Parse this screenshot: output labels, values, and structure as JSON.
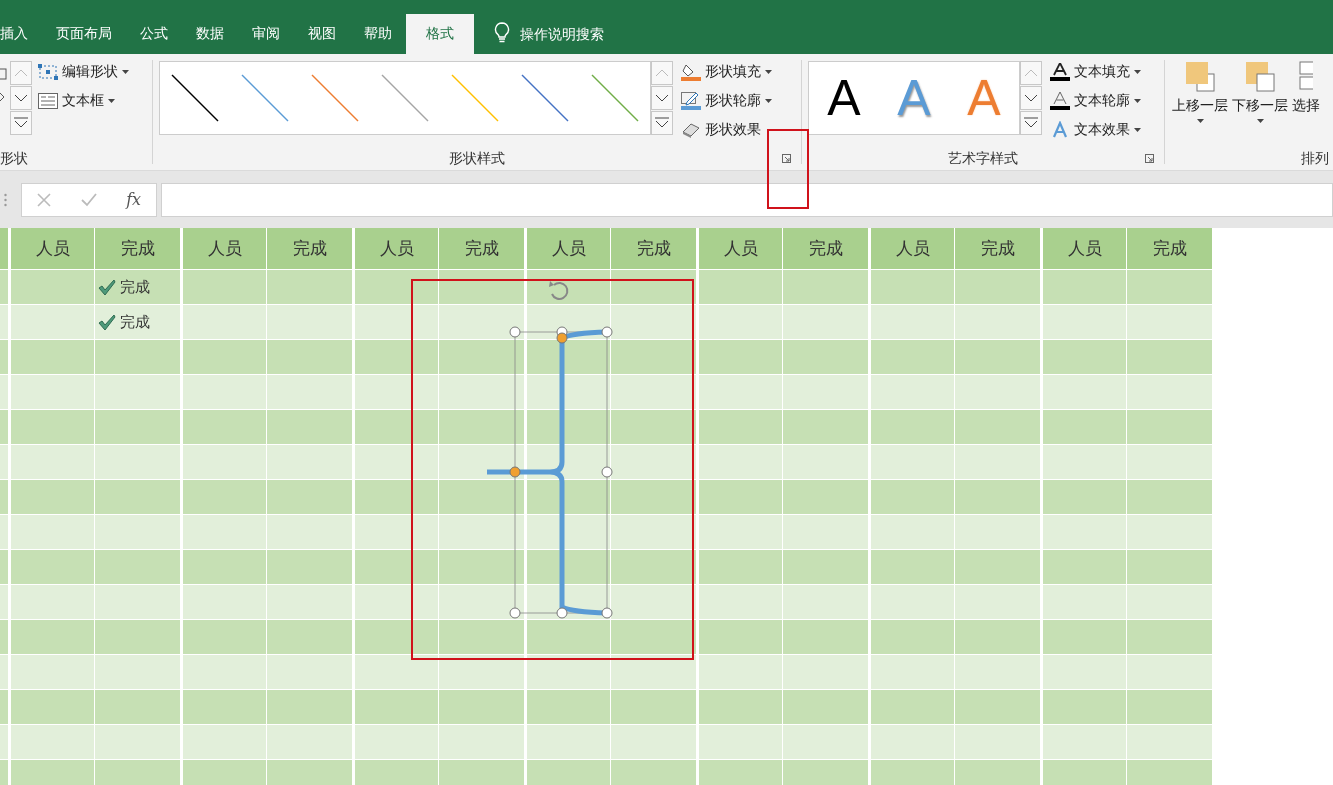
{
  "tabs": [
    {
      "label": "插入",
      "selected": false
    },
    {
      "label": "页面布局",
      "selected": false
    },
    {
      "label": "公式",
      "selected": false
    },
    {
      "label": "数据",
      "selected": false
    },
    {
      "label": "审阅",
      "selected": false
    },
    {
      "label": "视图",
      "selected": false
    },
    {
      "label": "帮助",
      "selected": false
    },
    {
      "label": "格式",
      "selected": true
    }
  ],
  "search": {
    "label": "操作说明搜索"
  },
  "ribbon": {
    "insert_shapes": {
      "label": "形状",
      "buttons": [
        {
          "label": "编辑形状",
          "kind": "edit"
        },
        {
          "label": "文本框",
          "kind": "textbox"
        }
      ]
    },
    "shape_styles": {
      "label": "形状样式",
      "swatches": [
        {
          "color": "#000000"
        },
        {
          "color": "#5b9bd5"
        },
        {
          "color": "#ed7d31"
        },
        {
          "color": "#a5a5a5"
        },
        {
          "color": "#ffc000"
        },
        {
          "color": "#4472c4"
        },
        {
          "color": "#70ad47"
        }
      ],
      "buttons": [
        {
          "label": "形状填充",
          "kind": "fill"
        },
        {
          "label": "形状轮廓",
          "kind": "outline"
        },
        {
          "label": "形状效果",
          "kind": "effect"
        }
      ]
    },
    "wordart_styles": {
      "label": "艺术字样式",
      "samples": [
        {
          "text": "A",
          "kind": "solid",
          "color": "#000000"
        },
        {
          "text": "A",
          "kind": "shadow",
          "color": "#5b9bd5"
        },
        {
          "text": "A",
          "kind": "outline",
          "color": "#ed7d31"
        }
      ],
      "buttons": [
        {
          "label": "文本填充",
          "kind": "fill"
        },
        {
          "label": "文本轮廓",
          "kind": "outline"
        },
        {
          "label": "文本效果",
          "kind": "effect"
        }
      ]
    },
    "arrange": {
      "label": "排列",
      "buttons": [
        {
          "label": "上移一层",
          "kind": "forward"
        },
        {
          "label": "下移一层",
          "kind": "backward"
        },
        {
          "label": "选择",
          "kind": "select"
        }
      ]
    }
  },
  "formula_bar": {
    "function_label": "fx"
  },
  "sheet": {
    "columns": [
      "人员",
      "完成",
      "人员",
      "完成",
      "人员",
      "完成",
      "人员",
      "完成",
      "人员",
      "完成",
      "人员",
      "完成",
      "人员",
      "完成"
    ],
    "entries": [
      {
        "text": "完成",
        "checked": true
      },
      {
        "text": "完成",
        "checked": true
      }
    ]
  }
}
